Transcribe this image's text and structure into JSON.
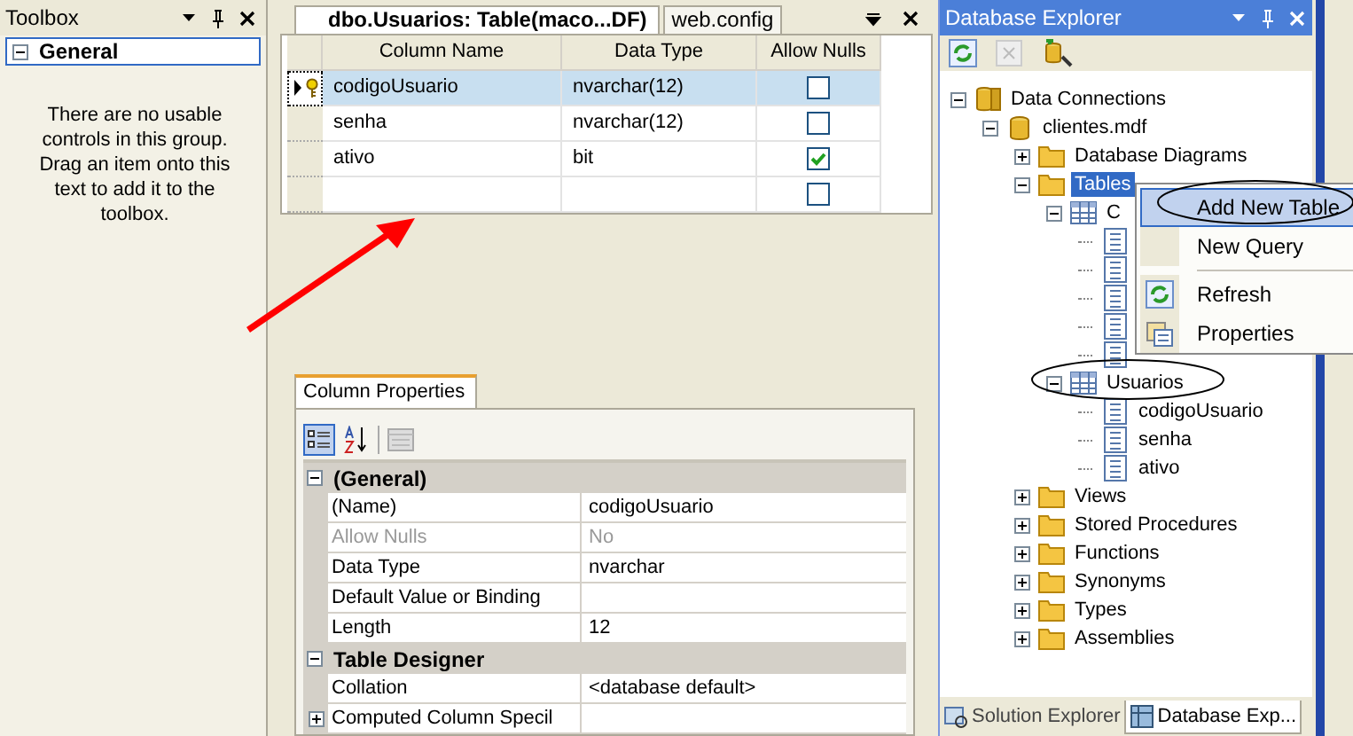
{
  "toolbox": {
    "title": "Toolbox",
    "group": {
      "label": "General",
      "expanded": true
    },
    "message": "There are no usable controls in this group. Drag an item onto this text to add it to the toolbox."
  },
  "document": {
    "tabs": [
      {
        "label": "dbo.Usuarios: Table(maco...DF)",
        "selected": true
      },
      {
        "label": "web.config",
        "selected": false
      }
    ],
    "table": {
      "columns": [
        "Column Name",
        "Data Type",
        "Allow Nulls"
      ],
      "rows": [
        {
          "name": "codigoUsuario",
          "type": "nvarchar(12)",
          "allow_nulls": false,
          "selected": true,
          "primary_key": true
        },
        {
          "name": "senha",
          "type": "nvarchar(12)",
          "allow_nulls": false,
          "selected": false,
          "primary_key": false
        },
        {
          "name": "ativo",
          "type": "bit",
          "allow_nulls": true,
          "selected": false,
          "primary_key": false
        },
        {
          "allow_nulls": false,
          "selected": false,
          "primary_key": false
        }
      ]
    }
  },
  "properties": {
    "tab": "Column Properties",
    "categories": [
      {
        "label": "(General)",
        "expanded": true,
        "items": [
          {
            "name": "(Name)",
            "value": "codigoUsuario",
            "disabled": false,
            "expandable": false
          },
          {
            "name": "Allow Nulls",
            "value": "No",
            "disabled": true,
            "expandable": false
          },
          {
            "name": "Data Type",
            "value": "nvarchar",
            "disabled": false,
            "expandable": false
          },
          {
            "name": "Default Value or Binding",
            "disabled": false,
            "expandable": false
          },
          {
            "name": "Length",
            "value": "12",
            "disabled": false,
            "expandable": false
          }
        ]
      },
      {
        "label": "Table Designer",
        "expanded": true,
        "items": [
          {
            "name": "Collation",
            "value": "<database default>",
            "disabled": false,
            "expandable": false
          },
          {
            "name": "Computed Column Specil",
            "disabled": false,
            "expandable": true
          }
        ]
      }
    ]
  },
  "db_explorer": {
    "title": "Database Explorer",
    "tree": [
      {
        "label": "Data Connections",
        "kind": "connections",
        "expanded": true,
        "children": [
          {
            "label": "clientes.mdf",
            "kind": "database",
            "expanded": true,
            "children": [
              {
                "label": "Database Diagrams",
                "kind": "folder",
                "expanded": false
              },
              {
                "label": "Tables",
                "kind": "folder",
                "expanded": true,
                "selected": true,
                "children": [
                  {
                    "label": "C",
                    "kind": "table",
                    "expanded": true,
                    "children": [
                      {
                        "kind": "column"
                      },
                      {
                        "kind": "column"
                      },
                      {
                        "kind": "column"
                      },
                      {
                        "kind": "column"
                      },
                      {
                        "kind": "column"
                      }
                    ]
                  },
                  {
                    "label": "Usuarios",
                    "kind": "table",
                    "expanded": true,
                    "children": [
                      {
                        "label": "codigoUsuario",
                        "kind": "column"
                      },
                      {
                        "label": "senha",
                        "kind": "column"
                      },
                      {
                        "label": "ativo",
                        "kind": "column"
                      }
                    ]
                  }
                ]
              },
              {
                "label": "Views",
                "kind": "folder",
                "expanded": false
              },
              {
                "label": "Stored Procedures",
                "kind": "folder",
                "expanded": false
              },
              {
                "label": "Functions",
                "kind": "folder",
                "expanded": false
              },
              {
                "label": "Synonyms",
                "kind": "folder",
                "expanded": false
              },
              {
                "label": "Types",
                "kind": "folder",
                "expanded": false
              },
              {
                "label": "Assemblies",
                "kind": "folder",
                "expanded": false
              }
            ]
          }
        ]
      }
    ],
    "bottom_tabs": [
      {
        "label": "Solution Explorer",
        "selected": false
      },
      {
        "label": "Database Exp...",
        "selected": true
      }
    ]
  },
  "context_menu": {
    "items": [
      {
        "kind": "item",
        "label": "Add New Table",
        "selected": true,
        "icon": false
      },
      {
        "kind": "item",
        "label": "New Query",
        "selected": false,
        "icon": false
      },
      {
        "kind": "separator"
      },
      {
        "kind": "item",
        "label": "Refresh",
        "selected": false,
        "icon": true
      },
      {
        "kind": "item",
        "label": "Properties",
        "selected": false,
        "icon": true
      }
    ]
  },
  "annotations": [
    {
      "kind": "arrow"
    },
    {
      "kind": "ellipse"
    },
    {
      "kind": "ellipse"
    }
  ]
}
